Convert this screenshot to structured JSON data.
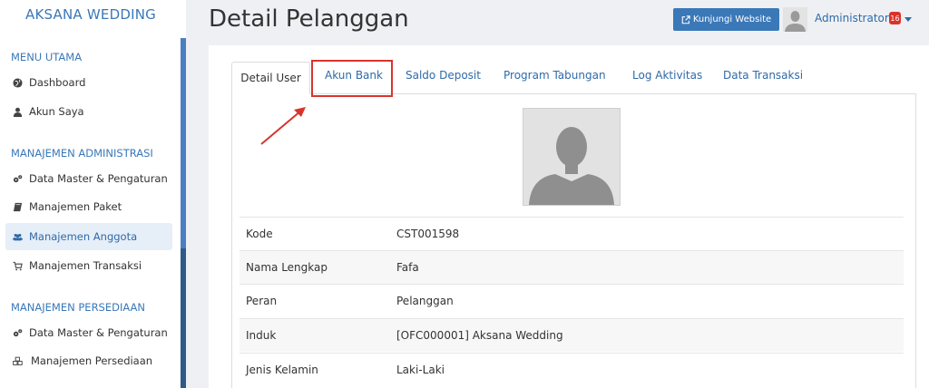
{
  "sidebar": {
    "brand": "AKSANA WEDDING",
    "sections": [
      {
        "title": "MENU UTAMA",
        "items": [
          {
            "label": "Dashboard",
            "icon": "globe-icon"
          },
          {
            "label": "Akun Saya",
            "icon": "user-icon"
          }
        ]
      },
      {
        "title": "MANAJEMEN ADMINISTRASI",
        "items": [
          {
            "label": "Data Master & Pengaturan",
            "icon": "cogs-icon"
          },
          {
            "label": "Manajemen Paket",
            "icon": "book-icon"
          },
          {
            "label": "Manajemen Anggota",
            "icon": "users-icon",
            "active": true
          },
          {
            "label": "Manajemen Transaksi",
            "icon": "cart-icon"
          }
        ]
      },
      {
        "title": "MANAJEMEN PERSEDIAAN",
        "items": [
          {
            "label": "Data Master & Pengaturan",
            "icon": "cogs-icon"
          },
          {
            "label": "Manajemen Persediaan",
            "icon": "cubes-icon"
          }
        ]
      }
    ]
  },
  "header": {
    "title": "Detail Pelanggan",
    "visit_button": "Kunjungi Website",
    "user_name": "Administrator",
    "notification_count": "16"
  },
  "tabs": [
    {
      "label": "Detail User",
      "active": true
    },
    {
      "label": "Akun Bank",
      "highlighted": true
    },
    {
      "label": "Saldo Deposit"
    },
    {
      "label": "Program Tabungan"
    },
    {
      "label": "Log Aktivitas"
    },
    {
      "label": "Data Transaksi"
    }
  ],
  "details": [
    {
      "key": "Kode",
      "value": "CST001598"
    },
    {
      "key": "Nama Lengkap",
      "value": "Fafa"
    },
    {
      "key": "Peran",
      "value": "Pelanggan"
    },
    {
      "key": "Induk",
      "value": "[OFC000001] Aksana Wedding"
    },
    {
      "key": "Jenis Kelamin",
      "value": "Laki-Laki"
    }
  ],
  "colors": {
    "accent": "#3a78b8",
    "highlight": "#d9342b"
  }
}
